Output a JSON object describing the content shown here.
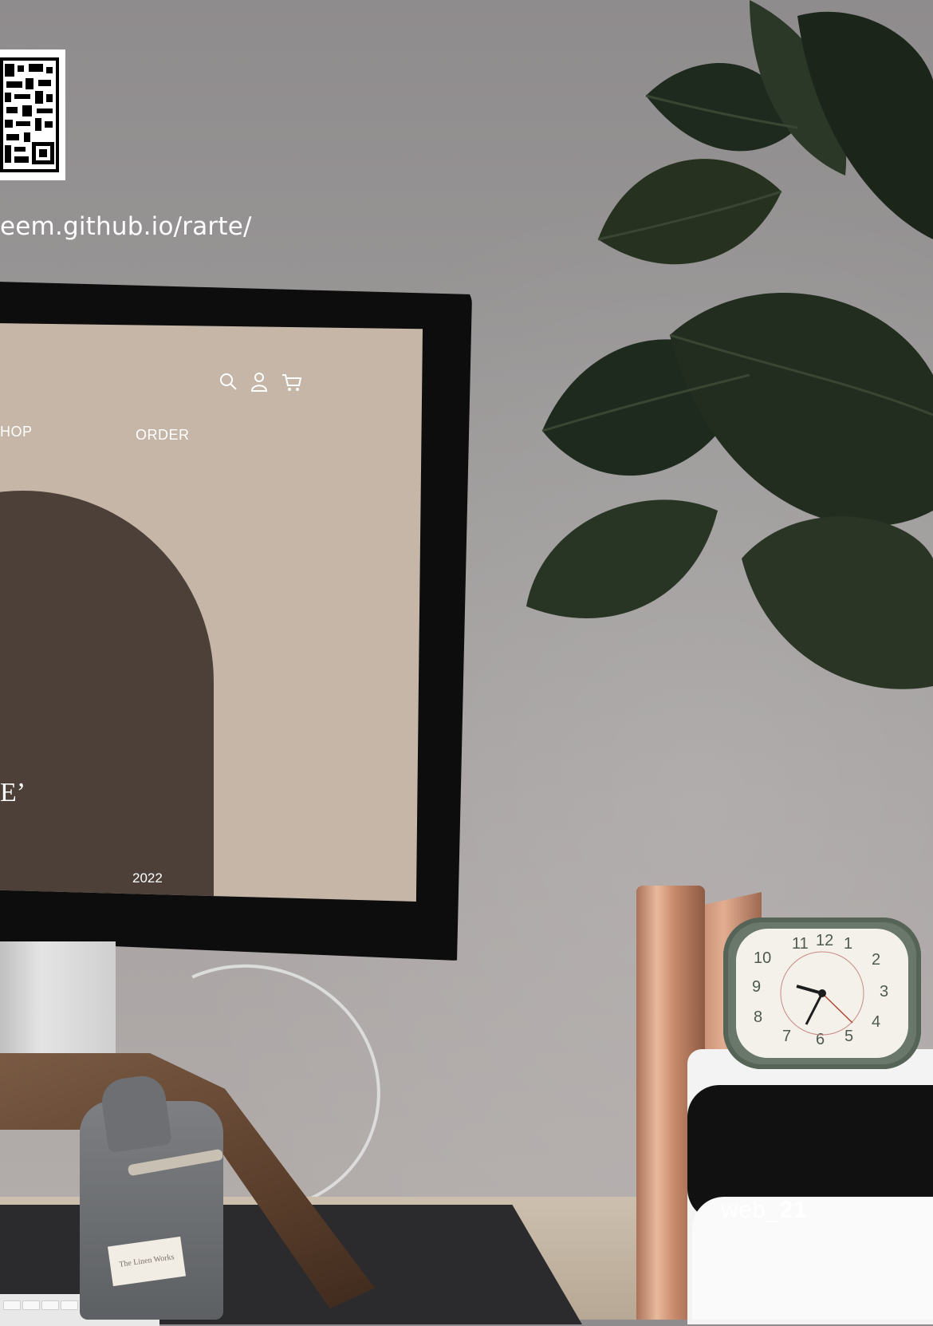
{
  "project_url": "eem.github.io/rarte/",
  "site": {
    "nav": [
      {
        "label": "HOP"
      },
      {
        "label": "ORDER"
      }
    ],
    "icons": [
      "search-icon",
      "user-icon",
      "cart-icon"
    ],
    "hero_title": "E’",
    "hero_year": "2022",
    "photo_glyph": "E",
    "colors": {
      "screen_bg": "#c5b6a7",
      "arch": "#4c4039",
      "text": "#ffffff"
    }
  },
  "pouch_label": "The Linen Works",
  "clock_numbers": [
    "11",
    "12",
    "1",
    "2",
    "10",
    "9",
    "3",
    "8",
    "4",
    "7",
    "6",
    "5"
  ],
  "page_label": {
    "prefix": "web_",
    "number": "21"
  }
}
